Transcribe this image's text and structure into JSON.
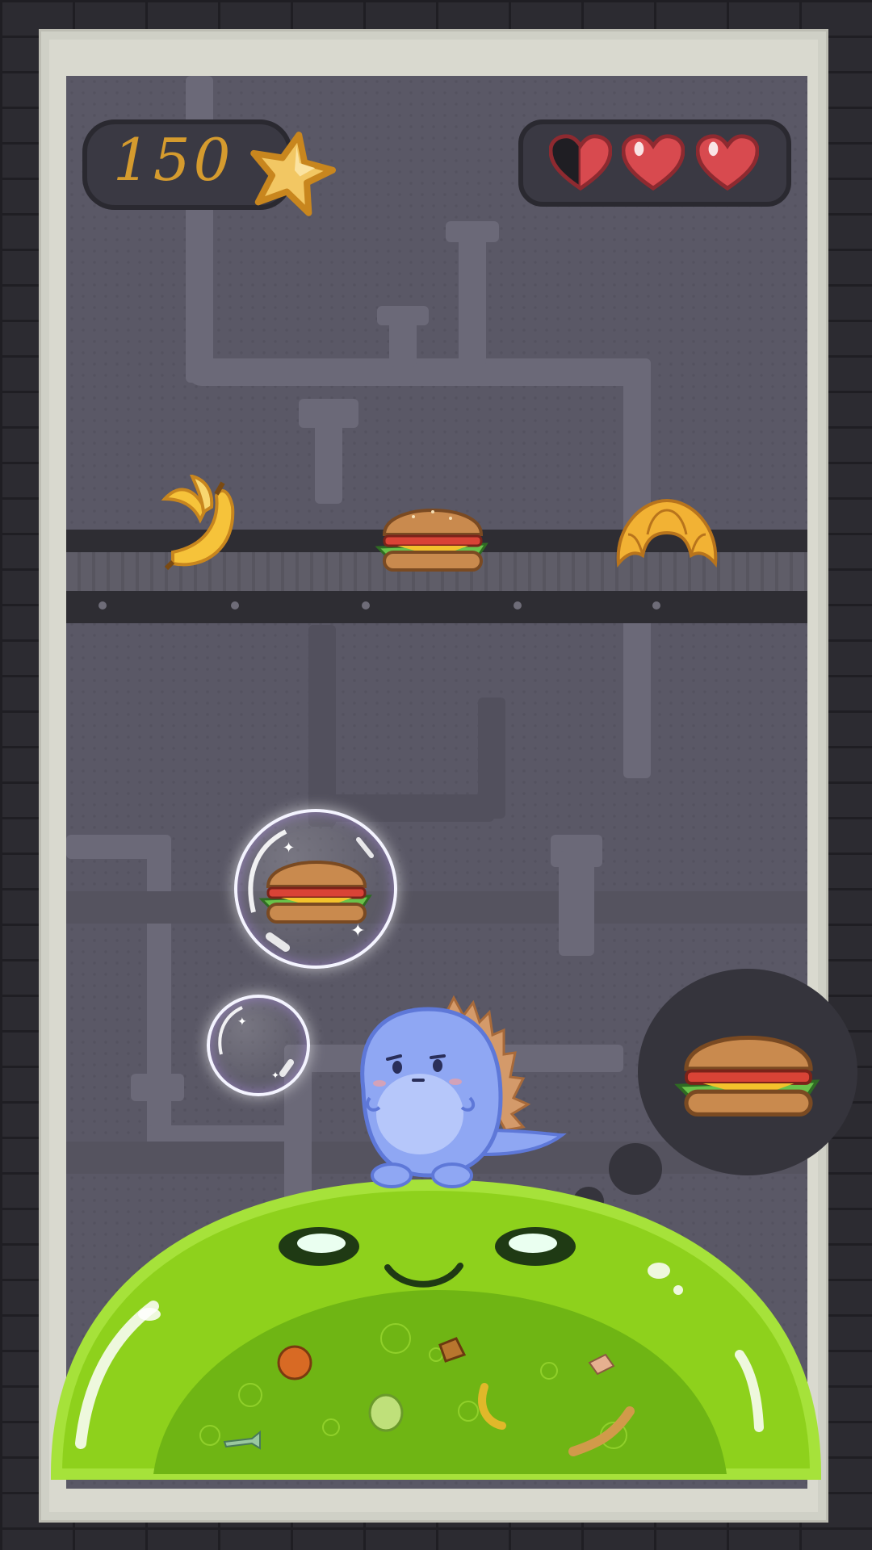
{
  "hud": {
    "score": "150",
    "score_icon": "star-icon",
    "lives_total": 3,
    "lives_remaining": 2.5,
    "heart_icons": [
      "heart-half-icon",
      "heart-full-icon",
      "heart-full-icon"
    ]
  },
  "conveyor": {
    "items": [
      "banana",
      "burger",
      "croissant"
    ]
  },
  "bubbles": {
    "large": "burger",
    "small": "empty"
  },
  "thought_bubble": {
    "wanted_food": "burger"
  },
  "colors": {
    "score": "#d59b2e",
    "heart": "#d84a4f",
    "slime": "#8ed11c",
    "dino": "#8fa7f3",
    "background": "#5a5866"
  }
}
